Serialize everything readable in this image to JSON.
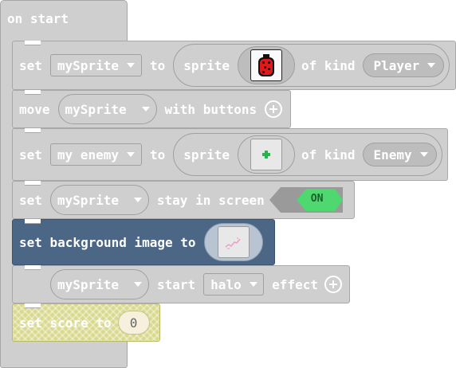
{
  "hat": {
    "label": "on start"
  },
  "blocks": {
    "b1": {
      "set": "set",
      "sprite_var": "mySprite",
      "to": "to",
      "sprite_word": "sprite",
      "of_kind": "of kind",
      "kind": "Player"
    },
    "b2": {
      "move": "move",
      "sprite_var": "mySprite",
      "with_buttons": "with buttons"
    },
    "b3": {
      "set": "set",
      "sprite_var": "my enemy",
      "to": "to",
      "sprite_word": "sprite",
      "of_kind": "of kind",
      "kind": "Enemy"
    },
    "b4": {
      "set": "set",
      "sprite_var": "mySprite",
      "stay": "stay in screen",
      "toggle": "ON"
    },
    "b5": {
      "label": "set background image to"
    },
    "b6": {
      "sprite_var": "mySprite",
      "start": "start",
      "effect_value": "halo",
      "effect": "effect"
    },
    "b7": {
      "label": "set score to",
      "value": "0"
    }
  },
  "colors": {
    "block_gray": "#cfcfcf",
    "background_block": "#4c6686",
    "score_block": "#d8d98c",
    "toggle_on": "#4fd86f"
  },
  "icons": {
    "player_sprite": "red-ladybug-icon",
    "enemy_sprite": "green-dot-icon",
    "background": "pink-scribble-icon",
    "add": "plus-circle-icon"
  }
}
